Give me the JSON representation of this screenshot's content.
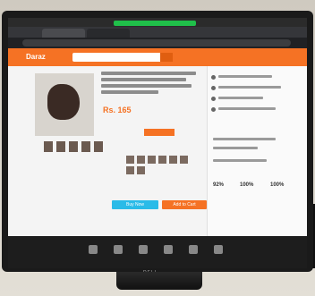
{
  "browser": {
    "share_banner": "",
    "tab_1": "",
    "tab_2": ""
  },
  "site": {
    "logo_text": "Daraz",
    "accent": "#f57224"
  },
  "product": {
    "price": "Rs. 165",
    "buy_now_label": "Buy Now",
    "add_to_cart_label": "Add to Cart"
  },
  "ratings": {
    "score_1": "92%",
    "score_2": "100%",
    "score_3": "100%"
  },
  "monitor": {
    "brand": "DELL"
  },
  "icons": [
    "search-icon",
    "share-icon",
    "heart-icon"
  ]
}
